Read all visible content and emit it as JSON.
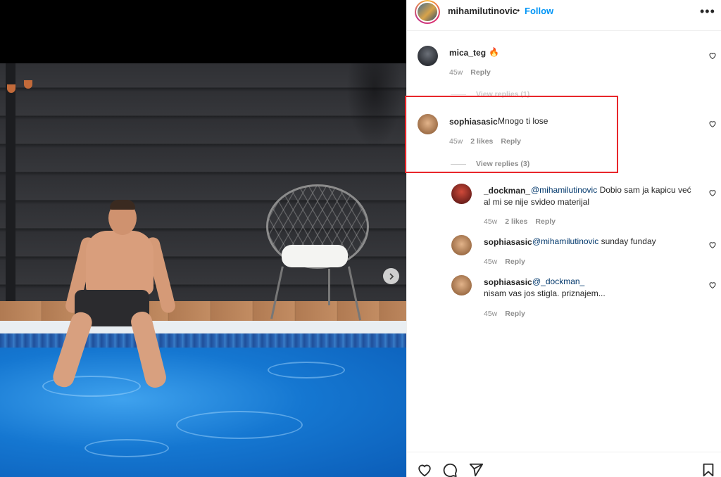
{
  "header": {
    "username": "mihamilutinovic",
    "dot": "•",
    "follow_label": "Follow",
    "more_label": "•••"
  },
  "comments": [
    {
      "username": "mica_teg",
      "text": "🔥",
      "time": "45w",
      "reply_label": "Reply",
      "view_replies": "View replies (1)"
    },
    {
      "username": "sophiasasic",
      "text": "Mnogo ti lose",
      "time": "45w",
      "likes": "2 likes",
      "reply_label": "Reply",
      "view_replies": "View replies (3)"
    }
  ],
  "replies": [
    {
      "username": "_dockman_",
      "mention": "@mihamilutinovic",
      "text": "Dobio sam ja kapicu već al mi se nije svideo materijal",
      "time": "45w",
      "likes": "2 likes",
      "reply_label": "Reply"
    },
    {
      "username": "sophiasasic",
      "mention": "@mihamilutinovic",
      "text": "sunday funday",
      "time": "45w",
      "reply_label": "Reply"
    },
    {
      "username": "sophiasasic",
      "mention": "@_dockman_",
      "text": "nisam vas jos stigla. priznajem...",
      "time": "45w",
      "reply_label": "Reply"
    }
  ],
  "colors": {
    "follow": "#0095f6",
    "mention": "#00376b",
    "highlight_box": "#e8262b",
    "meta_gray": "#8e8e8e"
  },
  "icons": {
    "like": "heart-icon",
    "comment": "comment-icon",
    "share": "share-icon",
    "save": "bookmark-icon",
    "carousel_next": "chevron-right-icon"
  }
}
